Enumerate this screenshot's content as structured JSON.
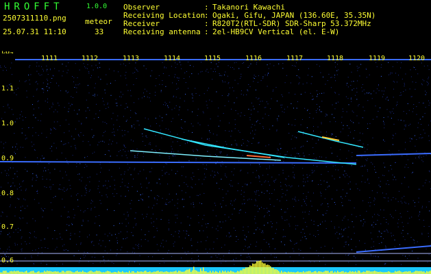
{
  "app": {
    "title": "HROFFT",
    "version": "1.0.0"
  },
  "file": {
    "name": "2507311110.png",
    "datetime": "25.07.31 11:10"
  },
  "meteor": {
    "label": "meteor",
    "count": "33"
  },
  "info": [
    {
      "label": "Observer",
      "value": "Takanori Kawachi"
    },
    {
      "label": "Receiving Location",
      "value": "Ogaki, Gifu, JAPAN (136.60E, 35.35N)"
    },
    {
      "label": "Receiver",
      "value": "R820T2(RTL-SDR) SDR-Sharp 53.372MHz"
    },
    {
      "label": "Receiving antenna",
      "value": "2el-HB9CV Vertical (el. E-W)"
    }
  ],
  "colon": ":",
  "axis": {
    "y_unit": "kHz",
    "y_ticks": [
      "1.1",
      "1.0",
      "0.9",
      "0.8",
      "0.7",
      "0.6"
    ],
    "x_ticks": [
      "1111",
      "1112",
      "1113",
      "1114",
      "1115",
      "1116",
      "1117",
      "1118",
      "1119",
      "1120"
    ]
  },
  "colors": {
    "background": "#000000",
    "label_green": "#33ff33",
    "label_yellow": "#ffff33",
    "trace_blue": "#3a6cff",
    "trace_cyan": "#33e6ff",
    "noise_blue": "#1a2b8a"
  }
}
